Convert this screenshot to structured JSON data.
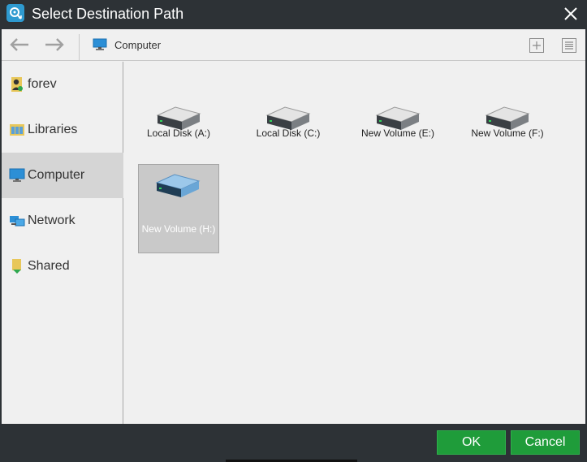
{
  "window": {
    "title": "Select Destination Path",
    "accent_color": "#1f9c3a",
    "titlebar_color": "#2d3236"
  },
  "toolbar": {
    "back_icon": "arrow-left-icon",
    "forward_icon": "arrow-right-icon",
    "path_icon": "computer-icon",
    "path_label": "Computer",
    "new_folder_icon": "plus-box-icon",
    "view_icon": "list-view-icon"
  },
  "sidebar": {
    "items": [
      {
        "label": "forev",
        "icon": "user-icon",
        "active": false
      },
      {
        "label": "Libraries",
        "icon": "libraries-icon",
        "active": false
      },
      {
        "label": "Computer",
        "icon": "computer-icon",
        "active": true
      },
      {
        "label": "Network",
        "icon": "network-icon",
        "active": false
      },
      {
        "label": "Shared",
        "icon": "shared-folder-icon",
        "active": false
      }
    ]
  },
  "drives": [
    {
      "label": "Local Disk (A:)",
      "selected": false
    },
    {
      "label": "Local Disk (C:)",
      "selected": false
    },
    {
      "label": "New Volume (E:)",
      "selected": false
    },
    {
      "label": "New Volume (F:)",
      "selected": false
    },
    {
      "label": "New Volume (H:)",
      "selected": true
    }
  ],
  "footer": {
    "ok_label": "OK",
    "cancel_label": "Cancel"
  }
}
